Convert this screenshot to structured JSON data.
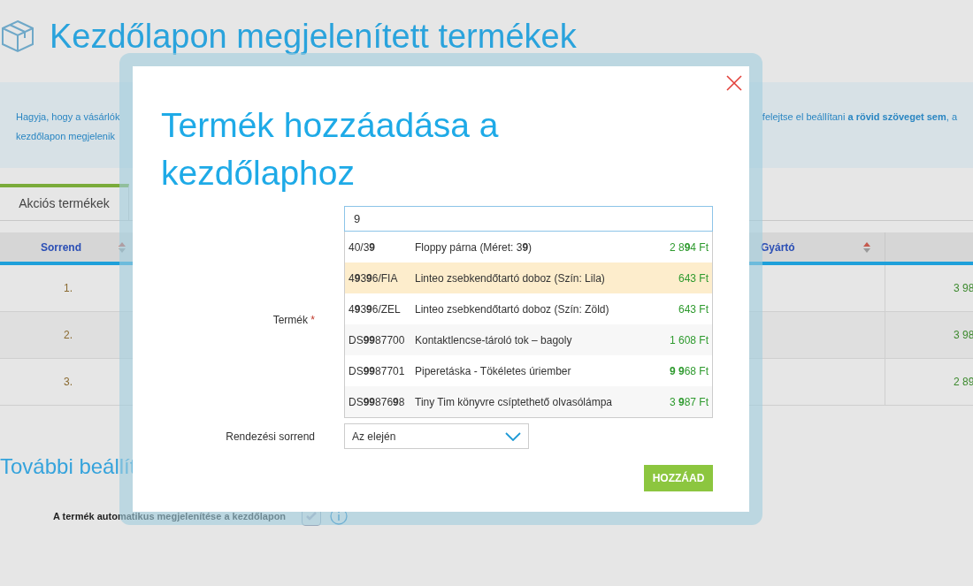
{
  "page": {
    "title": "Kezdőlapon megjelenített termékek",
    "info": {
      "left_lines": [
        "Hagyja, hogy a vásárlók",
        "kezdőlapon megjelenik"
      ],
      "right_lines": [
        "felejtse el beállítani **a rövid szöveget sem**, a"
      ]
    },
    "tabs": [
      {
        "label": "Akciós termékek",
        "selected": true
      }
    ],
    "table": {
      "columns": [
        {
          "label": "Sorrend"
        },
        {
          "label": "Gyártó"
        }
      ],
      "rows": [
        {
          "order": "1.",
          "price": "3 98"
        },
        {
          "order": "2.",
          "price": "3 98"
        },
        {
          "order": "3.",
          "price": "2 89"
        }
      ]
    },
    "settings_title": "További beállít",
    "settings": [
      {
        "label": "A termék automatikus megjelenítése a kezdőlapon",
        "checked": true
      }
    ]
  },
  "dialog": {
    "title": "Termék hozzáadása a kezdőlaphoz",
    "product_field": {
      "label": "Termék",
      "required_mark": "*",
      "value": "9"
    },
    "suggestions": [
      {
        "code": "40/3**9**",
        "name": "Floppy párna (Méret: 3**9**)",
        "price": "2 8**9**4 Ft",
        "selected": false
      },
      {
        "code": "4**9**3**9**6/FIA",
        "name": "Linteo zsebkendőtartó doboz (Szín: Lila)",
        "price": "643 Ft",
        "selected": true
      },
      {
        "code": "4**9**3**9**6/ZEL",
        "name": "Linteo zsebkendőtartó doboz (Szín: Zöld)",
        "price": "643 Ft",
        "selected": false
      },
      {
        "code": "DS**99**87700",
        "name": "Kontaktlencse-tároló tok – bagoly",
        "price": "1 608 Ft",
        "selected": false
      },
      {
        "code": "DS**99**87701",
        "name": "Piperetáska - Tökéletes úriember",
        "price": "**9 9**68 Ft",
        "selected": false
      },
      {
        "code": "DS**99**876**9**8",
        "name": "Tiny Tim könyvre csíptethető olvasólámpa",
        "price": "3 **9**87 Ft",
        "selected": false
      }
    ],
    "order_field": {
      "label": "Rendezési sorrend",
      "value": "Az elején"
    },
    "button": "HOZZÁAD"
  }
}
